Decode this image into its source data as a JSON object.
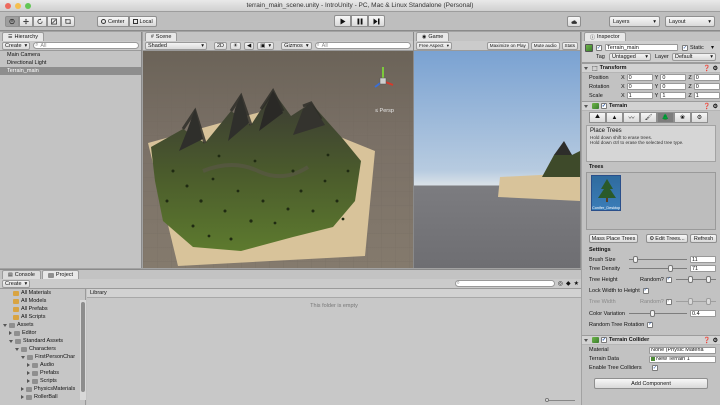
{
  "window": {
    "title": "terrain_main_scene.unity - IntroUnity - PC, Mac & Linux Standalone (Personal)",
    "traffic_lights": [
      "#ed6a5e",
      "#f5bf4f",
      "#62c655"
    ]
  },
  "toolbar": {
    "tools": [
      "hand-tool",
      "move-tool",
      "rotate-tool",
      "scale-tool",
      "rect-tool"
    ],
    "pivot_label": "Center",
    "space_label": "Local",
    "layers_label": "Layers",
    "layout_label": "Layout"
  },
  "hierarchy": {
    "tab": "Hierarchy",
    "create_label": "Create",
    "search_placeholder": "All",
    "items": [
      "Main Camera",
      "Directional Light",
      "Terrain_main"
    ],
    "selected_index": 2
  },
  "scene": {
    "tab": "Scene",
    "shading_label": "Shaded",
    "mode_2d": "2D",
    "gizmos_label": "Gizmos",
    "search_placeholder": "All",
    "persp_label": "Persp"
  },
  "game": {
    "tab": "Game",
    "aspect_label": "Free Aspect",
    "maximize_label": "Maximize on Play",
    "mute_label": "Mute audio",
    "stats_label": "Stats",
    "gizmos_label": "Gizmos"
  },
  "project": {
    "tabs": [
      "Console",
      "Project"
    ],
    "create_label": "Create",
    "tree_items": [
      {
        "label": "All Materials",
        "depth": 1,
        "type": "search"
      },
      {
        "label": "All Models",
        "depth": 1,
        "type": "search"
      },
      {
        "label": "All Prefabs",
        "depth": 1,
        "type": "search"
      },
      {
        "label": "All Scripts",
        "depth": 1,
        "type": "search"
      },
      {
        "label": "Assets",
        "depth": 0,
        "type": "folder",
        "open": true
      },
      {
        "label": "Editor",
        "depth": 1,
        "type": "folder"
      },
      {
        "label": "Standard Assets",
        "depth": 1,
        "type": "folder",
        "open": true
      },
      {
        "label": "Characters",
        "depth": 2,
        "type": "folder",
        "open": true
      },
      {
        "label": "FirstPersonChar",
        "depth": 3,
        "type": "folder",
        "open": true
      },
      {
        "label": "Audio",
        "depth": 4,
        "type": "folder"
      },
      {
        "label": "Prefabs",
        "depth": 4,
        "type": "folder"
      },
      {
        "label": "Scripts",
        "depth": 4,
        "type": "folder"
      },
      {
        "label": "PhysicsMaterials",
        "depth": 3,
        "type": "folder"
      },
      {
        "label": "RollerBall",
        "depth": 3,
        "type": "folder"
      }
    ],
    "library_label": "Library",
    "empty_message": "This folder is empty"
  },
  "inspector": {
    "tab": "Inspector",
    "object_name": "Terrain_main",
    "static_label": "Static",
    "tag_label": "Tag",
    "tag_value": "Untagged",
    "layer_label": "Layer",
    "layer_value": "Default",
    "transform": {
      "header": "Transform",
      "rows": [
        {
          "label": "Position",
          "x": "0",
          "y": "0",
          "z": "0"
        },
        {
          "label": "Rotation",
          "x": "0",
          "y": "0",
          "z": "0"
        },
        {
          "label": "Scale",
          "x": "1",
          "y": "1",
          "z": "1"
        }
      ],
      "axis_labels": [
        "X",
        "Y",
        "Z"
      ]
    },
    "terrain": {
      "header": "Terrain",
      "active_tool_index": 4,
      "help_title": "Place Trees",
      "help_lines": [
        "Hold down shift to erase trees.",
        "Hold down ctrl to erase the selected tree type."
      ],
      "trees_label": "Trees",
      "tree_name": "Conifer_Desktop",
      "mass_place_label": "Mass Place Trees",
      "edit_trees_label": "Edit Trees...",
      "refresh_label": "Refresh",
      "settings_label": "Settings",
      "brush_size_label": "Brush Size",
      "brush_size_value": "11",
      "brush_size_fraction": 0.11,
      "tree_density_label": "Tree Density",
      "tree_density_value": "71",
      "tree_density_fraction": 0.71,
      "tree_height_label": "Tree Height",
      "random_label": "Random?",
      "lock_width_label": "Lock Width to Height",
      "tree_width_label": "Tree Width",
      "color_variation_label": "Color Variation",
      "color_variation_value": "0.4",
      "color_variation_fraction": 0.4,
      "random_rotation_label": "Random Tree Rotation"
    },
    "collider": {
      "header": "Terrain Collider",
      "material_label": "Material",
      "material_value": "None (Physic Materia",
      "terrain_data_label": "Terrain Data",
      "terrain_data_value": "New Terrain 1",
      "enable_colliders_label": "Enable Tree Colliders"
    },
    "add_component_label": "Add Component"
  },
  "colors": {
    "selection": "#8e8e8e",
    "sky_top": "#7fa8d6",
    "sky_bottom": "#dbe4ec",
    "ground": "#d8c39a",
    "terrain_green": "#5a7a2c"
  }
}
